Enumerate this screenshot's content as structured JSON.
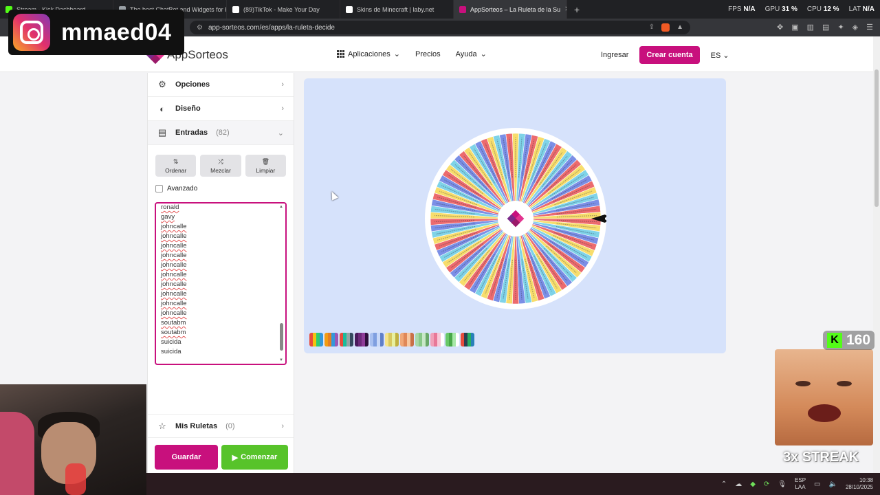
{
  "browser": {
    "tabs": [
      {
        "label": "Stream - Kick Dashboard",
        "color": "#53fc18",
        "active": false
      },
      {
        "label": "The best ChatBot and Widgets for Ki",
        "color": "#9aa0a6",
        "active": false
      },
      {
        "label": "(89)TikTok - Make Your Day",
        "color": "#ffffff",
        "active": false
      },
      {
        "label": "Skins de Minecraft | laby.net",
        "color": "#ffffff",
        "active": false
      },
      {
        "label": "AppSorteos – La Ruleta de la Su",
        "color": "#c8107d",
        "active": true
      }
    ],
    "new_tab": "+",
    "stats": [
      {
        "label": "FPS",
        "value": "N/A"
      },
      {
        "label": "GPU",
        "value": "31 %"
      },
      {
        "label": "CPU",
        "value": "12 %"
      },
      {
        "label": "LAT",
        "value": "N/A"
      }
    ],
    "url": "app-sorteos.com/es/apps/la-ruleta-decide"
  },
  "stream_overlay": {
    "username": "mmaed04",
    "kick_count": "160",
    "streak": "3x STREAK"
  },
  "nav": {
    "brand": "AppSorteos",
    "menu": [
      {
        "label": "Aplicaciones",
        "has_chevron": true
      },
      {
        "label": "Precios",
        "has_chevron": false
      },
      {
        "label": "Ayuda",
        "has_chevron": true
      }
    ],
    "login": "Ingresar",
    "register": "Crear cuenta",
    "language": "ES"
  },
  "sidebar": {
    "options_label": "Opciones",
    "design_label": "Diseño",
    "entries_label": "Entradas",
    "entries_count": "(82)",
    "tools": [
      {
        "label": "Ordenar",
        "icon": "sort-icon"
      },
      {
        "label": "Mezclar",
        "icon": "shuffle-icon"
      },
      {
        "label": "Limpiar",
        "icon": "trash-icon"
      }
    ],
    "advanced_label": "Avanzado",
    "entries_visible": [
      "ronald",
      "gavy",
      "johncalle",
      "johncalle",
      "johncalle",
      "johncalle",
      "johncalle",
      "johncalle",
      "johncalle",
      "johncalle",
      "johncalle",
      "johncalle",
      "soutabm",
      "soutabm",
      "suicida",
      "suicida"
    ],
    "my_wheels_label": "Mis Ruletas",
    "my_wheels_count": "(0)",
    "save_label": "Guardar",
    "start_label": "Comenzar"
  },
  "wheel": {
    "segment_count": 82,
    "segment_colors": [
      "#ec6b6e",
      "#f7dd6c",
      "#7fd3e8",
      "#7b8fe6"
    ],
    "palettes": [
      [
        "#e74c3c",
        "#f1c40f",
        "#2ecc71",
        "#3498db"
      ],
      [
        "#f39c12",
        "#e67e22",
        "#3498db",
        "#9b59b6"
      ],
      [
        "#e74c3c",
        "#1abc9c",
        "#95a5a6",
        "#34495e"
      ],
      [
        "#4a1a5c",
        "#6c2a7a",
        "#8e3c98",
        "#2e0f3a"
      ],
      [
        "#a8c0f0",
        "#7f9fe0",
        "#c8d8f8",
        "#5f7fc8"
      ],
      [
        "#f4e38a",
        "#d8c860",
        "#e8f0a0",
        "#c0b040"
      ],
      [
        "#f0a878",
        "#e08858",
        "#f8c8a0",
        "#c87048"
      ],
      [
        "#a8d8a8",
        "#88c888",
        "#c8e8c8",
        "#68a868"
      ],
      [
        "#f0a0b8",
        "#e87898",
        "#f8c8d8",
        "#ffffff"
      ],
      [
        "#68c868",
        "#48a848",
        "#a8e8a8",
        "#ffffff"
      ],
      [
        "#e74c3c",
        "#2c3e50",
        "#27ae60",
        "#2980b9"
      ]
    ]
  },
  "taskbar": {
    "lang_top": "ESP",
    "lang_bottom": "LAA",
    "time": "10:38",
    "date": "28/10/2025"
  }
}
